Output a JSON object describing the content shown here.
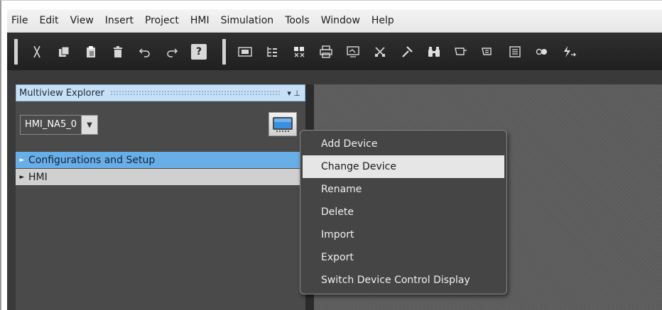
{
  "menubar": {
    "items": [
      "File",
      "Edit",
      "View",
      "Insert",
      "Project",
      "HMI",
      "Simulation",
      "Tools",
      "Window",
      "Help"
    ]
  },
  "toolbar": {
    "help_glyph": "?",
    "icons": [
      "cut-icon",
      "copy-icon",
      "paste-icon",
      "delete-icon",
      "undo-icon",
      "redo-icon",
      "help-icon",
      "3d-icon",
      "hierarchy-icon",
      "grid-icon",
      "print-icon",
      "screen-icon",
      "tools-icon",
      "build-icon",
      "binoculars-icon",
      "device-icon",
      "device-alt-icon",
      "list-icon",
      "online-icon",
      "transfer-icon"
    ]
  },
  "explorer": {
    "title": "Multiview Explorer",
    "pin_glyph": "▾ ⊥",
    "device_select": {
      "value": "HMI_NA5_0",
      "arrow": "▼"
    },
    "tree": [
      {
        "label": "Configurations and Setup",
        "caret": "►"
      },
      {
        "label": "HMI",
        "caret": "►"
      }
    ]
  },
  "context_menu": {
    "items": [
      {
        "label": "Add Device",
        "highlighted": false
      },
      {
        "label": "Change Device",
        "highlighted": true
      },
      {
        "label": "Rename",
        "highlighted": false
      },
      {
        "label": "Delete",
        "highlighted": false
      },
      {
        "label": "Import",
        "highlighted": false
      },
      {
        "label": "Export",
        "highlighted": false
      },
      {
        "label": "Switch Device Control Display",
        "highlighted": false
      }
    ]
  },
  "colors": {
    "toolbar_bg": "#262626",
    "selection_blue": "#6aaee8",
    "title_bar": "#c8e0f6",
    "menu_bg": "#454545",
    "menu_highlight": "#e6e6e6"
  }
}
